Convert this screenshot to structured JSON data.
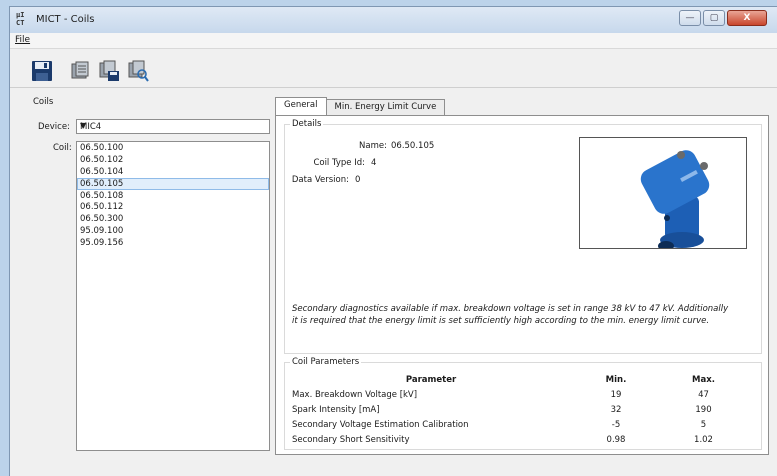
{
  "window": {
    "title": "MICT - Coils",
    "icon_text": "µI\nCT",
    "controls": {
      "minimize": "—",
      "maximize": "▢",
      "close": "X"
    }
  },
  "menu": {
    "file": "File"
  },
  "toolbar": {
    "buttons": [
      {
        "name": "save",
        "icon": "floppy-disk-icon"
      },
      {
        "name": "coil-1",
        "icon": "coil-icon"
      },
      {
        "name": "coil-save",
        "icon": "coil-save-icon"
      },
      {
        "name": "coil-search",
        "icon": "coil-search-icon"
      }
    ]
  },
  "left": {
    "section_label": "Coils",
    "device_label": "Device:",
    "device_value": "MIC4",
    "coil_label": "Coil:",
    "coils": [
      "06.50.100",
      "06.50.102",
      "06.50.104",
      "06.50.105",
      "06.50.108",
      "06.50.112",
      "06.50.300",
      "95.09.100",
      "95.09.156"
    ],
    "selected_index": 3
  },
  "tabs": [
    {
      "label": "General",
      "active": true
    },
    {
      "label": "Min. Energy Limit Curve",
      "active": false
    }
  ],
  "details": {
    "title": "Details",
    "name_label": "Name:",
    "name_value": "06.50.105",
    "type_label": "Coil Type Id:",
    "type_value": "4",
    "version_label": "Data Version:",
    "version_value": "0",
    "note": "Secondary diagnostics available if max. breakdown voltage is set in range 38 kV to 47 kV. Additionally it is required that the energy limit is set sufficiently high according to the min. energy limit curve."
  },
  "params": {
    "title": "Coil Parameters",
    "headers": [
      "Parameter",
      "Min.",
      "Max."
    ],
    "rows": [
      [
        "Max. Breakdown Voltage [kV]",
        "19",
        "47"
      ],
      [
        "Spark Intensity [mA]",
        "32",
        "190"
      ],
      [
        "Secondary Voltage Estimation Calibration",
        "-5",
        "5"
      ],
      [
        "Secondary Short Sensitivity",
        "0.98",
        "1.02"
      ]
    ]
  },
  "colors": {
    "accent": "#1f6fc5",
    "selection": "#e1eefb",
    "title_bg": "#c7d8ec"
  }
}
